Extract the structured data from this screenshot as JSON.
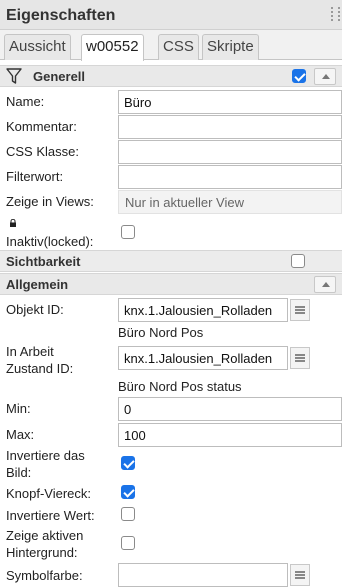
{
  "panel": {
    "title": "Eigenschaften"
  },
  "tabs": [
    "Aussicht",
    "w00552",
    "CSS",
    "Skripte"
  ],
  "sections": {
    "generell": "Generell",
    "sichtbarkeit": "Sichtbarkeit",
    "allgemein": "Allgemein"
  },
  "generell": {
    "name_label": "Name:",
    "name_value": "Büro",
    "kommentar_label": "Kommentar:",
    "css_klasse_label": "CSS Klasse:",
    "filterwort_label": "Filterwort:",
    "zeige_label": "Zeige in Views:",
    "zeige_value": "Nur in aktueller View",
    "inaktiv_label": "Inaktiv(locked):"
  },
  "allgemein": {
    "objekt_id_label": "Objekt ID:",
    "objekt_id_value": "knx.1.Jalousien_Rolladen",
    "objekt_id_desc": "Büro Nord Pos",
    "in_arbeit_label_1": "In Arbeit",
    "in_arbeit_label_2": "Zustand ID:",
    "in_arbeit_value": "knx.1.Jalousien_Rolladen",
    "in_arbeit_desc": "Büro Nord Pos status",
    "min_label": "Min:",
    "min_value": "0",
    "max_label": "Max:",
    "max_value": "100",
    "invertiere_bild_1": "Invertiere das",
    "invertiere_bild_2": "Bild:",
    "knopf_label": "Knopf-Viereck:",
    "invertiere_wert_label": "Invertiere Wert:",
    "zeige_aktiven_1": "Zeige aktiven",
    "zeige_aktiven_2": "Hintergrund:",
    "symbolfarbe_label": "Symbolfarbe:"
  },
  "checkboxes": {
    "generell": true,
    "inaktiv": false,
    "sichtbarkeit": false,
    "invertiere_bild": true,
    "knopf_viereck": true,
    "invertiere_wert": false,
    "zeige_aktiven": false
  },
  "colors": {
    "accent": "#1a73e8",
    "header_bg": "#e6e6e6",
    "section_bg": "#e9e9e9"
  }
}
